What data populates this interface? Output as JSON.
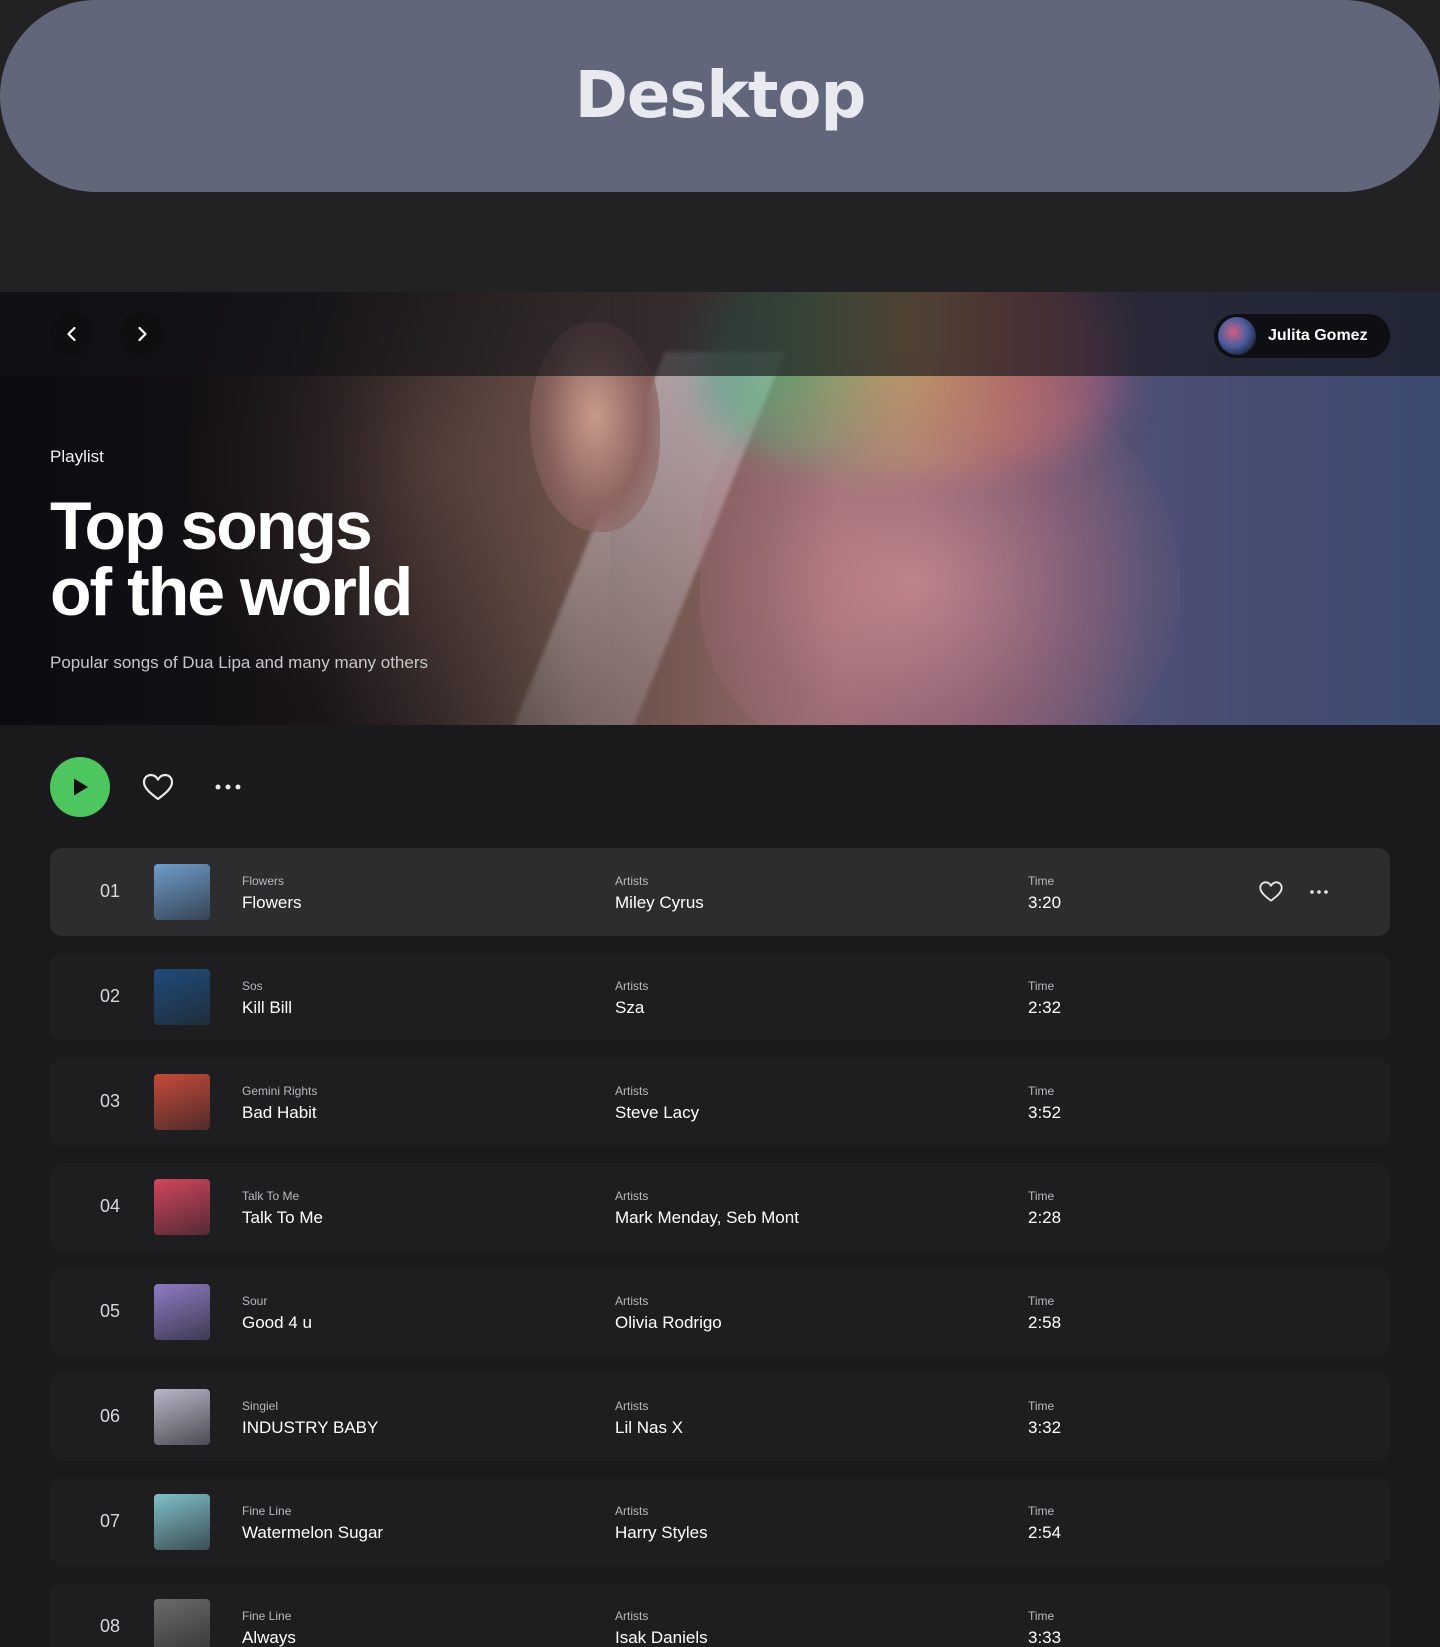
{
  "banner": {
    "title": "Desktop"
  },
  "user": {
    "name": "Julita Gomez"
  },
  "hero": {
    "kicker": "Playlist",
    "title_line1": "Top songs",
    "title_line2": "of the world",
    "subtitle": "Popular songs of Dua Lipa and many many others"
  },
  "colors": {
    "accent": "#4ec65f",
    "page_bg": "#1a1a1c",
    "row_bg": "#1e1e21",
    "row_active_bg": "#2d2d30",
    "banner_bg": "#62667a"
  },
  "icons": {
    "back": "chevron-left-icon",
    "forward": "chevron-right-icon",
    "play": "play-icon",
    "like": "heart-icon",
    "more": "more-horizontal-icon"
  },
  "columns": {
    "artists": "Artists",
    "time": "Time"
  },
  "tracks": [
    {
      "num": "01",
      "album": "Flowers",
      "title": "Flowers",
      "artist": "Miley Cyrus",
      "time": "3:20",
      "cover": "#6f9ccc"
    },
    {
      "num": "02",
      "album": "Sos",
      "title": "Kill Bill",
      "artist": "Sza",
      "time": "2:32",
      "cover": "#1f4c7a"
    },
    {
      "num": "03",
      "album": "Gemini Rights",
      "title": "Bad Habit",
      "artist": "Steve Lacy",
      "time": "3:52",
      "cover": "#c64a3a"
    },
    {
      "num": "04",
      "album": "Talk To Me",
      "title": "Talk To Me",
      "artist": "Mark Menday, Seb Mont",
      "time": "2:28",
      "cover": "#d2455c"
    },
    {
      "num": "05",
      "album": "Sour",
      "title": "Good 4 u",
      "artist": "Olivia Rodrigo",
      "time": "2:58",
      "cover": "#8d7bc4"
    },
    {
      "num": "06",
      "album": "Singiel",
      "title": "INDUSTRY BABY",
      "artist": "Lil Nas X",
      "time": "3:32",
      "cover": "#b9b7c8"
    },
    {
      "num": "07",
      "album": "Fine Line",
      "title": "Watermelon Sugar",
      "artist": "Harry Styles",
      "time": "2:54",
      "cover": "#7fc0c9"
    },
    {
      "num": "08",
      "album": "Fine Line",
      "title": "Always",
      "artist": "Isak Daniels",
      "time": "3:33",
      "cover": "#6b6b6b"
    }
  ]
}
